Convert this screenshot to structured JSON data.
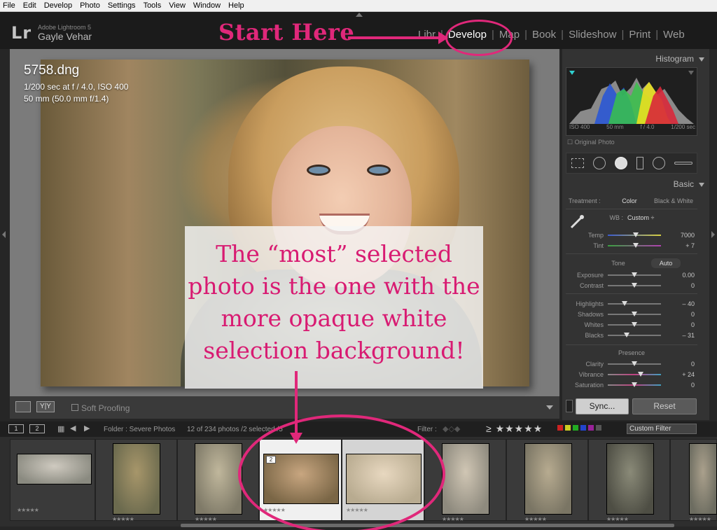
{
  "menu": [
    "File",
    "Edit",
    "Develop",
    "Photo",
    "Settings",
    "Tools",
    "View",
    "Window",
    "Help"
  ],
  "identity": {
    "logo": "Lr",
    "version": "Adobe Lightroom 5",
    "user": "Gayle Vehar"
  },
  "modules": [
    {
      "label": "Libr",
      "active": false
    },
    {
      "label": "Develop",
      "active": true
    },
    {
      "label": "Map",
      "active": false
    },
    {
      "label": "Book",
      "active": false
    },
    {
      "label": "Slideshow",
      "active": false
    },
    {
      "label": "Print",
      "active": false
    },
    {
      "label": "Web",
      "active": false
    }
  ],
  "photo_info": {
    "filename": "5758.dng",
    "exposure": "1/200 sec at f / 4.0, ISO 400",
    "lens": "50 mm (50.0 mm f/1.4)"
  },
  "annotations": {
    "start_here": "Start Here",
    "note": "The “most” selected photo is the one with the more opaque white selection background!"
  },
  "histogram": {
    "title": "Histogram",
    "iso": "ISO 400",
    "focal": "50 mm",
    "aperture": "f / 4.0",
    "shutter": "1/200 sec",
    "original_photo": "Original Photo"
  },
  "basic": {
    "title": "Basic",
    "treatment_label": "Treatment :",
    "treatment_color": "Color",
    "treatment_bw": "Black & White",
    "wb_label": "WB :",
    "wb_value": "Custom ÷",
    "tone_label": "Tone",
    "auto_label": "Auto",
    "presence_label": "Presence",
    "sliders": [
      {
        "name": "Temp",
        "value": "7000",
        "level": 0.52
      },
      {
        "name": "Tint",
        "value": "+ 7",
        "level": 0.52
      },
      {
        "name": "Exposure",
        "value": "0.00",
        "level": 0.5
      },
      {
        "name": "Contrast",
        "value": "0",
        "level": 0.5
      },
      {
        "name": "Highlights",
        "value": "– 40",
        "level": 0.32
      },
      {
        "name": "Shadows",
        "value": "0",
        "level": 0.5
      },
      {
        "name": "Whites",
        "value": "0",
        "level": 0.5
      },
      {
        "name": "Blacks",
        "value": "– 31",
        "level": 0.36
      },
      {
        "name": "Clarity",
        "value": "0",
        "level": 0.5
      },
      {
        "name": "Vibrance",
        "value": "+ 24",
        "level": 0.62
      },
      {
        "name": "Saturation",
        "value": "0",
        "level": 0.5
      }
    ],
    "sync": "Sync...",
    "reset": "Reset"
  },
  "toolbar": {
    "soft_proofing": "Soft Proofing",
    "yy": "Y|Y"
  },
  "filmstrip_header": {
    "page1": "1",
    "page2": "2",
    "folder": "Folder : Severe Photos",
    "count": "12 of 234 photos /2 selected /5",
    "filter": "Filter :",
    "stars": "≥ ★★★★★",
    "custom_filter": "Custom Filter"
  },
  "filmstrip": {
    "stars": "★★★★★",
    "selected_number": "2"
  }
}
